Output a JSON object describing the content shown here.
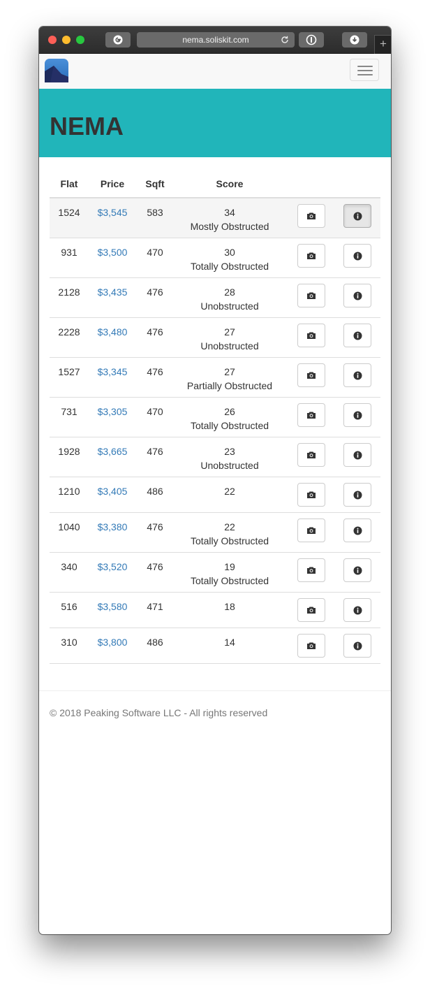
{
  "browser": {
    "url": "nema.soliskit.com",
    "new_tab_glyph": "+"
  },
  "header": {
    "title": "NEMA"
  },
  "table": {
    "columns": [
      "Flat",
      "Price",
      "Sqft",
      "Score"
    ],
    "rows": [
      {
        "flat": "1524",
        "price": "$3,545",
        "sqft": "583",
        "score": "34",
        "status": "Mostly Obstructed"
      },
      {
        "flat": "931",
        "price": "$3,500",
        "sqft": "470",
        "score": "30",
        "status": "Totally Obstructed"
      },
      {
        "flat": "2128",
        "price": "$3,435",
        "sqft": "476",
        "score": "28",
        "status": "Unobstructed"
      },
      {
        "flat": "2228",
        "price": "$3,480",
        "sqft": "476",
        "score": "27",
        "status": "Unobstructed"
      },
      {
        "flat": "1527",
        "price": "$3,345",
        "sqft": "476",
        "score": "27",
        "status": "Partially Obstructed"
      },
      {
        "flat": "731",
        "price": "$3,305",
        "sqft": "470",
        "score": "26",
        "status": "Totally Obstructed"
      },
      {
        "flat": "1928",
        "price": "$3,665",
        "sqft": "476",
        "score": "23",
        "status": "Unobstructed"
      },
      {
        "flat": "1210",
        "price": "$3,405",
        "sqft": "486",
        "score": "22",
        "status": ""
      },
      {
        "flat": "1040",
        "price": "$3,380",
        "sqft": "476",
        "score": "22",
        "status": "Totally Obstructed"
      },
      {
        "flat": "340",
        "price": "$3,520",
        "sqft": "476",
        "score": "19",
        "status": "Totally Obstructed"
      },
      {
        "flat": "516",
        "price": "$3,580",
        "sqft": "471",
        "score": "18",
        "status": ""
      },
      {
        "flat": "310",
        "price": "$3,800",
        "sqft": "486",
        "score": "14",
        "status": ""
      }
    ]
  },
  "footer": {
    "text": "© 2018 Peaking Software LLC - All rights reserved"
  },
  "colors": {
    "hero_bg": "#21b5ba",
    "link": "#337ab7",
    "highlight_row": "#f5f5f5"
  },
  "icons": [
    "google-icon",
    "reload-icon",
    "reader-icon",
    "download-icon",
    "camera-icon",
    "info-icon",
    "hamburger-icon",
    "app-logo"
  ]
}
